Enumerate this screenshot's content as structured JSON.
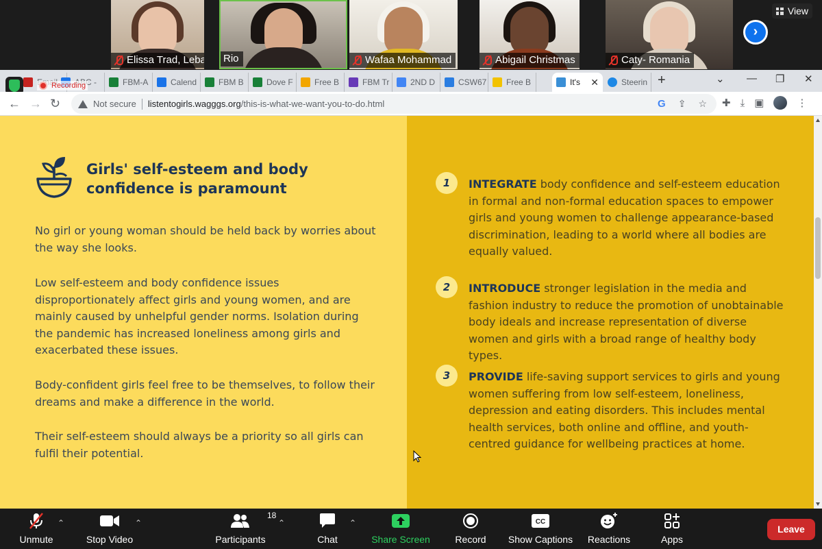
{
  "zoom_gallery": {
    "participants": [
      {
        "name": "Elissa Trad, Lebanon",
        "muted": true
      },
      {
        "name": "Rio",
        "muted": false
      },
      {
        "name": "Wafaa Mohammad",
        "muted": true
      },
      {
        "name": "Abigail Christmas",
        "muted": true
      },
      {
        "name": "Caty- Romania",
        "muted": true
      }
    ],
    "view_label": "View"
  },
  "browser": {
    "tabs": [
      {
        "label": "Email",
        "favicon_color": "#c5221f"
      },
      {
        "label": "ABC -",
        "favicon_color": "#1a73e8"
      },
      {
        "label": "FBM-A",
        "favicon_color": "#188038"
      },
      {
        "label": "Calend",
        "favicon_color": "#1a73e8"
      },
      {
        "label": "FBM B",
        "favicon_color": "#188038"
      },
      {
        "label": "Dove F",
        "favicon_color": "#188038"
      },
      {
        "label": "Free B",
        "favicon_color": "#f2a600"
      },
      {
        "label": "FBM Tr",
        "favicon_color": "#673ab7"
      },
      {
        "label": "2ND D",
        "favicon_color": "#4285f4"
      },
      {
        "label": "CSW67",
        "favicon_color": "#2a7de1"
      },
      {
        "label": "Free B",
        "favicon_color": "#f2c200"
      },
      {
        "label": "It's",
        "favicon_color": "#3a8fd6",
        "active": true
      },
      {
        "label": "Steerin",
        "favicon_color": "#1e88e5"
      }
    ],
    "recording_label": "Recording",
    "address": {
      "security_label": "Not secure",
      "host": "listentogirls.wagggs.org",
      "path": "/this-is-what-we-want-you-to-do.html"
    }
  },
  "page": {
    "heading": "Girls' self-esteem and body confidence is paramount",
    "paragraphs": [
      "No girl or young woman should be held back by worries about the way she looks.",
      "Low self-esteem and body confidence issues disproportionately affect girls and young women, and are mainly caused by unhelpful gender norms. Isolation during the pandemic has increased loneliness among girls and exacerbated these issues.",
      "Body-confident girls feel free to be themselves, to follow their dreams and make a difference in the world.",
      "Their self-esteem should always be a priority so all girls can fulfil their potential."
    ],
    "actions": [
      {
        "number": "1",
        "keyword": "INTEGRATE",
        "text": " body confidence and self-esteem education in formal and non-formal education spaces to empower girls and young women to challenge appearance-based discrimination, leading to a world where all bodies are equally valued."
      },
      {
        "number": "2",
        "keyword": "INTRODUCE",
        "text": " stronger legislation in the media and fashion industry to reduce the promotion of unobtainable body ideals and increase representation of diverse women and girls with a broad range of healthy body types."
      },
      {
        "number": "3",
        "keyword": "PROVIDE",
        "text": " life-saving support services to girls and young women suffering from low self-esteem, loneliness, depression and eating disorders. This includes mental health services, both online and offline, and youth-centred guidance for wellbeing practices at home."
      }
    ]
  },
  "zoom_toolbar": {
    "unmute": "Unmute",
    "stop_video": "Stop Video",
    "participants": "Participants",
    "participants_count": "18",
    "chat": "Chat",
    "share_screen": "Share Screen",
    "record": "Record",
    "show_captions": "Show Captions",
    "reactions": "Reactions",
    "apps": "Apps",
    "leave": "Leave"
  },
  "colors": {
    "left_panel": "#fcdb5c",
    "right_panel": "#e8b812",
    "heading_navy": "#1d3557",
    "leave_red": "#cc2a2a",
    "share_green": "#2dd05f"
  }
}
